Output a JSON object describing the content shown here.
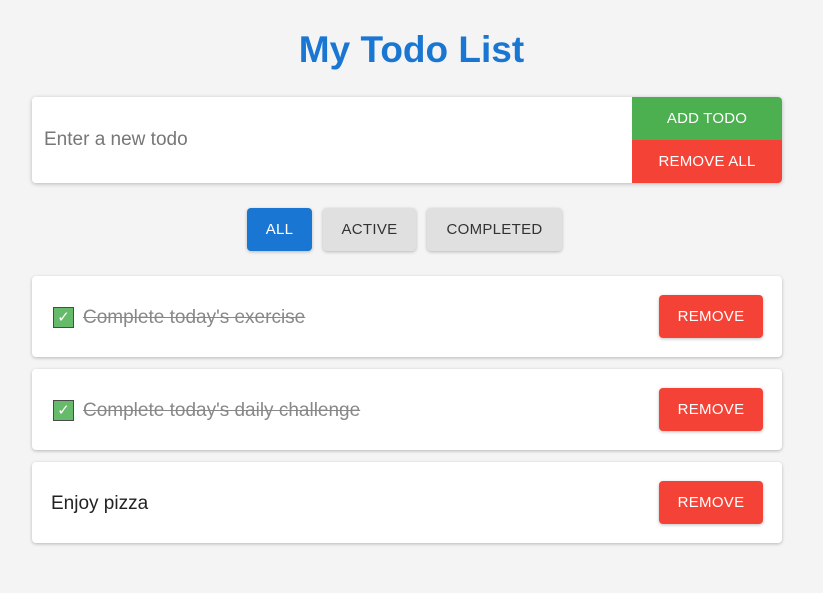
{
  "app": {
    "title": "My Todo List"
  },
  "input": {
    "placeholder": "Enter a new todo",
    "value": ""
  },
  "actions": {
    "add_label": "Add Todo",
    "remove_all_label": "Remove All"
  },
  "filters": {
    "selected": "All",
    "items": [
      {
        "label": "All",
        "active": true
      },
      {
        "label": "Active",
        "active": false
      },
      {
        "label": "Completed",
        "active": false
      }
    ]
  },
  "todos": [
    {
      "text": "Complete today's exercise",
      "completed": true,
      "remove_label": "Remove"
    },
    {
      "text": "Complete today's daily challenge",
      "completed": true,
      "remove_label": "Remove"
    },
    {
      "text": "Enjoy pizza",
      "completed": false,
      "remove_label": "Remove"
    }
  ],
  "colors": {
    "primary": "#1976d2",
    "add": "#4caf50",
    "danger": "#f44336",
    "checkbox": "#66bb6a",
    "background": "#f4f4f4"
  },
  "icons": {
    "checkbox": "check-icon"
  }
}
